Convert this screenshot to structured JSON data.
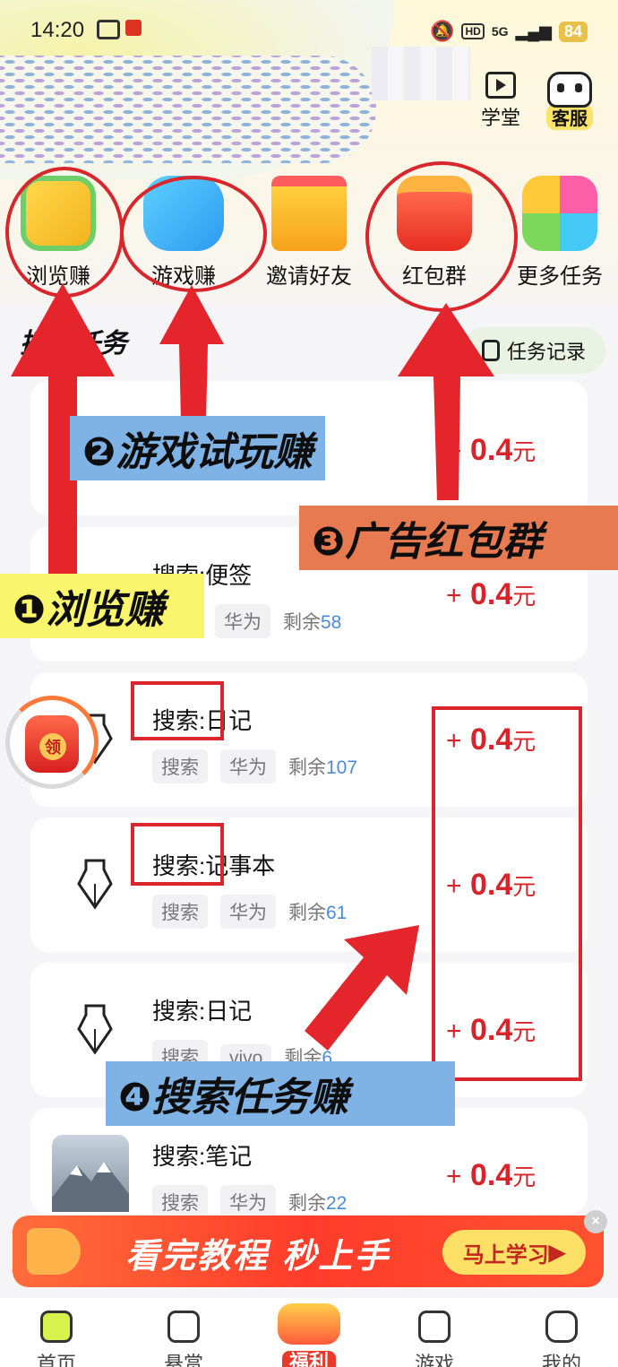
{
  "status": {
    "time": "14:20",
    "network": "5G",
    "hd": "HD",
    "battery": "84"
  },
  "header": {
    "school_label": "学堂",
    "service_label": "客服"
  },
  "quick_actions": [
    {
      "label": "浏览赚"
    },
    {
      "label": "游戏赚"
    },
    {
      "label": "邀请好友"
    },
    {
      "label": "红包群"
    },
    {
      "label": "更多任务"
    }
  ],
  "tasks": {
    "title": "搜索任务",
    "record_label": "任务记录"
  },
  "task_cards": [
    {
      "title": "",
      "tags": [],
      "remaining_label": "",
      "remaining": "",
      "reward_plus": "+",
      "reward": "0.4",
      "unit": "元"
    },
    {
      "title": "搜索:便签",
      "tags": [
        "华为"
      ],
      "remaining_label": "剩余",
      "remaining": "58",
      "reward_plus": "+",
      "reward": "0.4",
      "unit": "元"
    },
    {
      "title": "搜索:日记",
      "tags": [
        "搜索",
        "华为"
      ],
      "remaining_label": "剩余",
      "remaining": "107",
      "reward_plus": "+",
      "reward": "0.4",
      "unit": "元"
    },
    {
      "title": "搜索:记事本",
      "tags": [
        "搜索",
        "华为"
      ],
      "remaining_label": "剩余",
      "remaining": "61",
      "reward_plus": "+",
      "reward": "0.4",
      "unit": "元"
    },
    {
      "title": "搜索:日记",
      "tags": [
        "搜索",
        "vivo"
      ],
      "remaining_label": "剩余",
      "remaining": "6",
      "reward_plus": "+",
      "reward": "0.4",
      "unit": "元"
    },
    {
      "title": "搜索:笔记",
      "tags": [
        "搜索",
        "华为"
      ],
      "remaining_label": "剩余",
      "remaining": "22",
      "reward_plus": "+",
      "reward": "0.4",
      "unit": "元"
    }
  ],
  "callouts": {
    "browse": "❶浏览赚",
    "game": "❷游戏试玩赚",
    "ad": "❸广告红包群",
    "search": "❹搜索任务赚"
  },
  "floating_badge": {
    "label": "领"
  },
  "promo": {
    "text": "看完教程 秒上手",
    "button": "马上学习",
    "close": "×"
  },
  "tabbar": [
    {
      "label": "首页"
    },
    {
      "label": "悬赏"
    },
    {
      "label": "福利"
    },
    {
      "label": "游戏"
    },
    {
      "label": "我的"
    }
  ],
  "colors": {
    "accent_red": "#d6242a",
    "annotation_red": "#d8262c",
    "blue_callout": "#7fb3e6",
    "yellow_callout": "#f9f56d",
    "orange_callout": "#e87a52"
  }
}
